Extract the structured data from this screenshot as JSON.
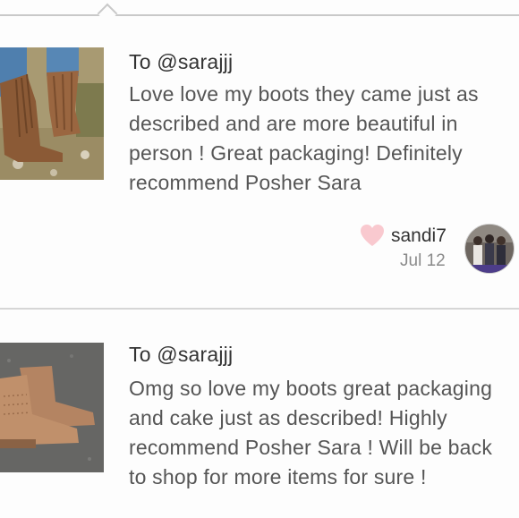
{
  "reviews": [
    {
      "recipient": "To @sarajjj",
      "text": "Love love my boots they came just as described and are more beautiful in person ! Great packaging! Definitely recommend Posher Sara",
      "author": "sandi7",
      "date": "Jul 12",
      "liked_icon": "heart-icon",
      "image_description_icon": "fringe-boots-photo"
    },
    {
      "recipient": "To @sarajjj",
      "text": "Omg so love my boots great packaging and cake just as described! Highly recommend Posher Sara ! Will be back to shop for more items for sure !",
      "image_description_icon": "ankle-boots-photo"
    }
  ],
  "colors": {
    "heart": "#f9c9cf",
    "divider": "#c9c9c9",
    "text_primary": "#333333",
    "text_body": "#555555",
    "text_muted": "#8a8a8a"
  }
}
